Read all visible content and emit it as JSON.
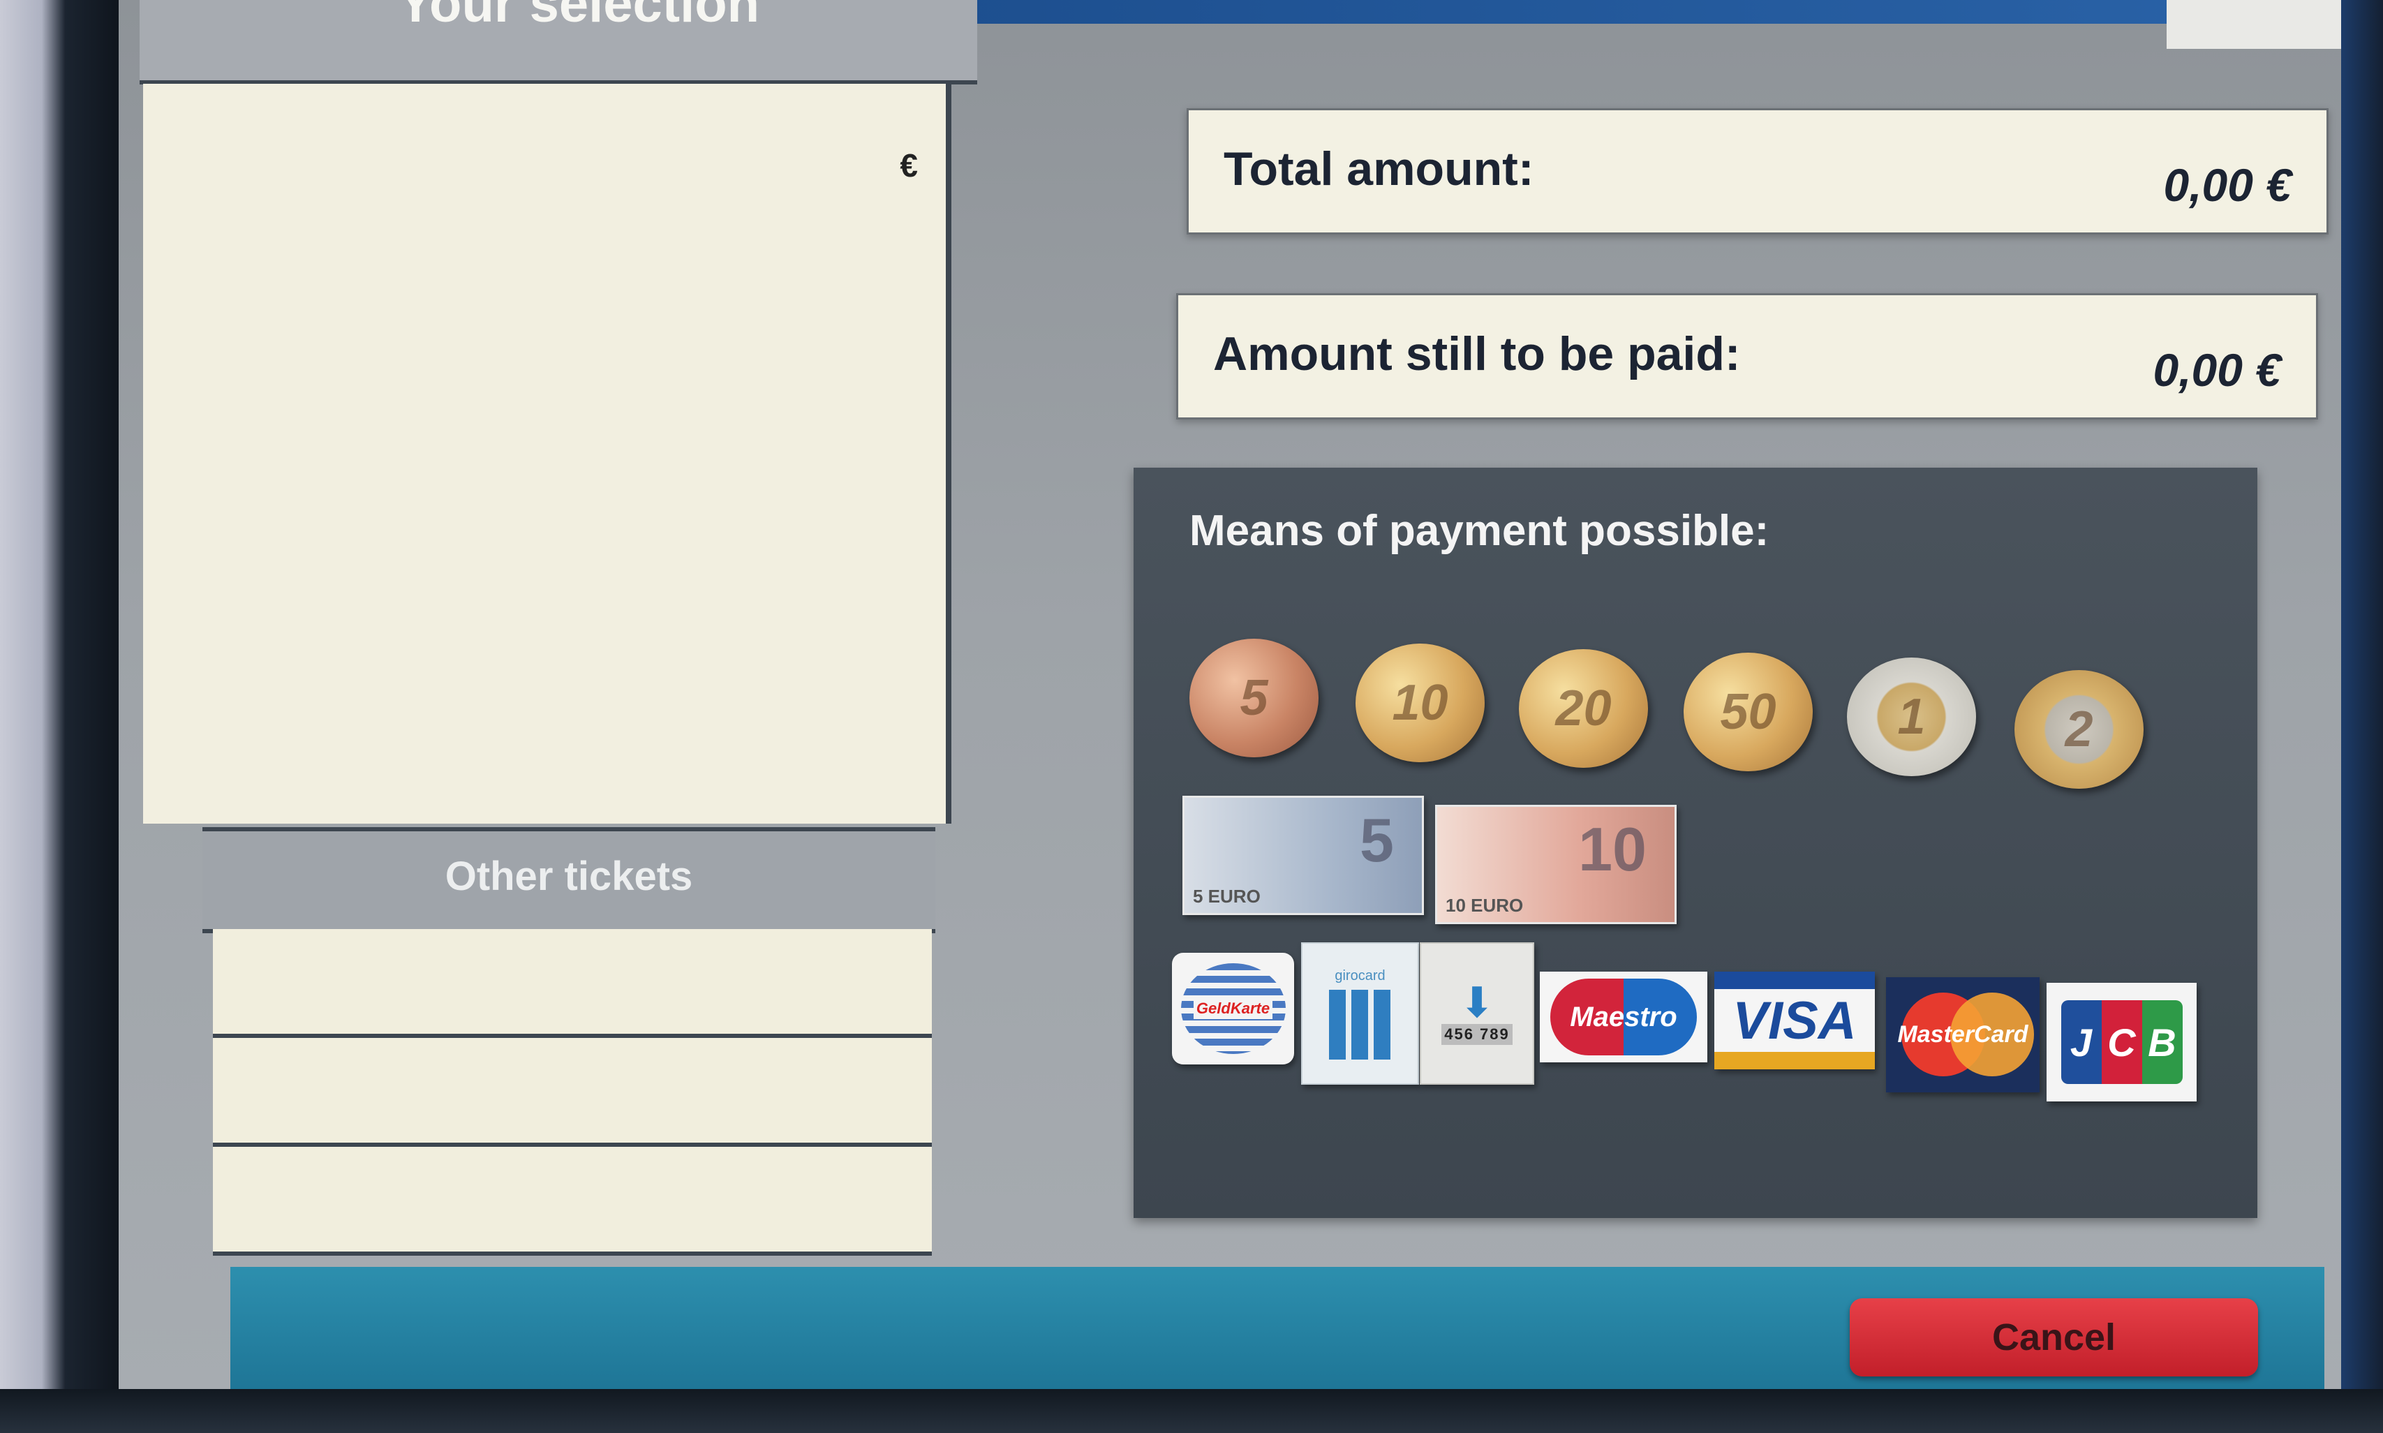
{
  "selection": {
    "header_label": "Your selection",
    "currency_symbol": "€"
  },
  "other_tickets": {
    "header_label": "Other tickets",
    "rows": [
      "",
      "",
      ""
    ]
  },
  "amounts": {
    "total_label": "Total amount:",
    "total_value": "0,00 €",
    "remaining_label": "Amount still to be paid:",
    "remaining_value": "0,00 €"
  },
  "payment": {
    "title": "Means of payment possible:",
    "coins": [
      {
        "label": "5",
        "name": "5-cent-coin-icon",
        "style": "copper"
      },
      {
        "label": "10",
        "name": "10-cent-coin-icon",
        "style": "gold"
      },
      {
        "label": "20",
        "name": "20-cent-coin-icon",
        "style": "gold"
      },
      {
        "label": "50",
        "name": "50-cent-coin-icon",
        "style": "gold"
      },
      {
        "label": "1",
        "name": "1-euro-coin-icon",
        "style": "bimetal"
      },
      {
        "label": "2",
        "name": "2-euro-coin-icon",
        "style": "bimetal2"
      }
    ],
    "notes": [
      {
        "big": "5",
        "small": "5 EURO",
        "name": "5-euro-note-icon"
      },
      {
        "big": "10",
        "small": "10 EURO",
        "name": "10-euro-note-icon"
      }
    ],
    "cards": {
      "geldkarte": "GeldKarte",
      "girocard": "girocard",
      "ec_keys": "456 789",
      "maestro": "Maestro",
      "visa": "VISA",
      "mastercard": "MasterCard",
      "jcb": [
        "J",
        "C",
        "B"
      ]
    }
  },
  "actions": {
    "cancel_label": "Cancel"
  },
  "colors": {
    "cancel": "#d62b34",
    "bottom_bar": "#2485a6",
    "panel": "#434c55"
  }
}
